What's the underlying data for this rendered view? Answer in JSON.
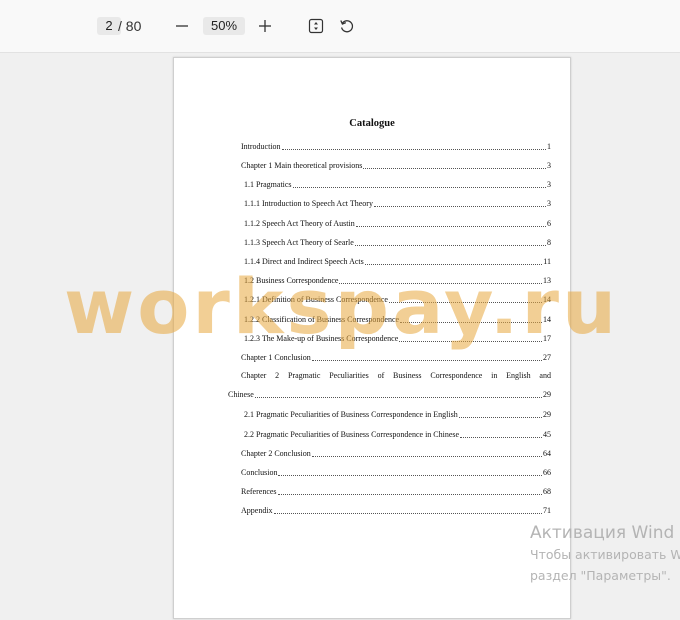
{
  "toolbar": {
    "current_page": "2",
    "total_pages": "/ 80",
    "zoom_level": "50%"
  },
  "document": {
    "title": "Catalogue",
    "toc": [
      {
        "label": "Introduction",
        "page": "1"
      },
      {
        "label": "Chapter 1 Main theoretical provisions",
        "page": "3"
      },
      {
        "label": "1.1 Pragmatics",
        "page": "3"
      },
      {
        "label": "1.1.1 Introduction to Speech Act Theory",
        "page": "3"
      },
      {
        "label": "1.1.2 Speech Act Theory of Austin",
        "page": "6"
      },
      {
        "label": "1.1.3 Speech Act Theory of Searle",
        "page": "8"
      },
      {
        "label": "1.1.4 Direct and Indirect Speech Acts",
        "page": "11"
      },
      {
        "label": "1.2 Business Correspondence",
        "page": "13"
      },
      {
        "label": "1.2.1 Definition of Business Correspondence",
        "page": "14"
      },
      {
        "label": "1.2.2 Classification of Business Correspondence",
        "page": "14"
      },
      {
        "label": "1.2.3 The Make-up of Business Correspondence",
        "page": "17"
      },
      {
        "label": "Chapter 1 Conclusion",
        "page": "27"
      },
      {
        "label": "Chinese",
        "page": "29"
      },
      {
        "label": "2.1 Pragmatic Peculiarities of Business Correspondence in English",
        "page": "29"
      },
      {
        "label": "2.2 Pragmatic Peculiarities of Business Correspondence in Chinese",
        "page": "45"
      },
      {
        "label": "Chapter 2 Conclusion",
        "page": "64"
      },
      {
        "label": "Conclusion",
        "page": "66"
      },
      {
        "label": "References",
        "page": "68"
      },
      {
        "label": "Appendix",
        "page": "71"
      }
    ],
    "chapter2_first_line": [
      "Chapter",
      "2",
      "Pragmatic",
      "Peculiarities",
      "of",
      "Business",
      "Correspondence",
      "in",
      "English",
      "and"
    ]
  },
  "watermark": "workspay.ru",
  "activation_notice": {
    "title": "Активация Wind",
    "line1": "Чтобы активировать W",
    "line2": "раздел \"Параметры\"."
  }
}
